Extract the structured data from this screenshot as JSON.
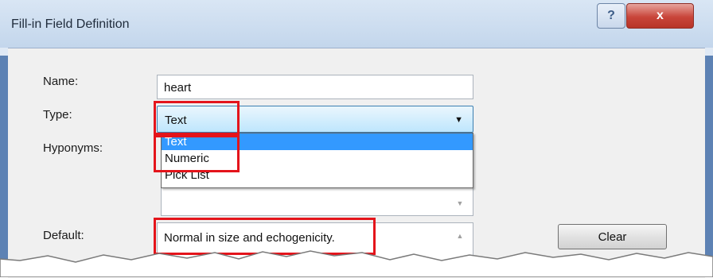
{
  "window": {
    "title": "Fill-in Field Definition",
    "help_label": "?",
    "close_label": "x"
  },
  "form": {
    "name_label": "Name:",
    "name_value": "heart",
    "type_label": "Type:",
    "type_value": "Text",
    "hyponyms_label": "Hyponyms:",
    "default_label": "Default:",
    "default_value": "Normal in size and echogenicity.",
    "clear_label": "Clear"
  },
  "type_options": [
    "Text",
    "Numeric",
    "Pick List"
  ],
  "colors": {
    "highlight": "#e4141b",
    "selection": "#3399ff",
    "close_button": "#c9453a"
  }
}
